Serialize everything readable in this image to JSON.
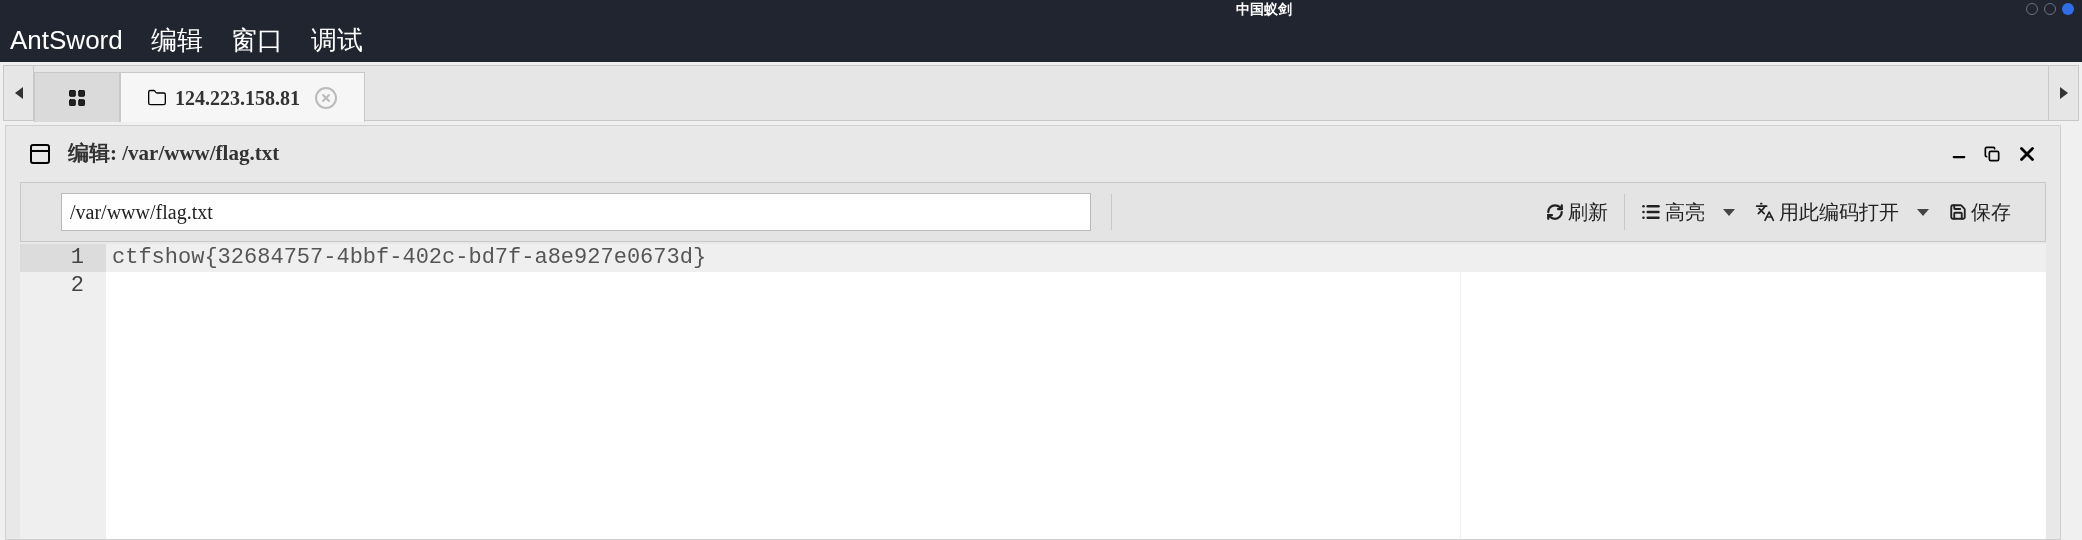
{
  "window": {
    "title": "中国蚁剑"
  },
  "menu": [
    "AntSword",
    "编辑",
    "窗口",
    "调试"
  ],
  "tabs": [
    {
      "kind": "home",
      "selected": false
    },
    {
      "kind": "host",
      "label": "124.223.158.81",
      "selected": true
    }
  ],
  "panel": {
    "title": "编辑: /var/www/flag.txt"
  },
  "toolbar": {
    "path": "/var/www/flag.txt",
    "buttons": [
      {
        "kind": "refresh",
        "label": "刷新",
        "dropdown": false
      },
      {
        "kind": "highlight",
        "label": "高亮",
        "dropdown": true
      },
      {
        "kind": "encoding",
        "label": "用此编码打开",
        "dropdown": true
      },
      {
        "kind": "save",
        "label": "保存",
        "dropdown": false
      }
    ]
  },
  "editor": {
    "lines": [
      {
        "number": "1",
        "text": "ctfshow{32684757-4bbf-402c-bd7f-a8e927e0673d}",
        "active": true
      },
      {
        "number": "2",
        "active": false
      }
    ]
  }
}
